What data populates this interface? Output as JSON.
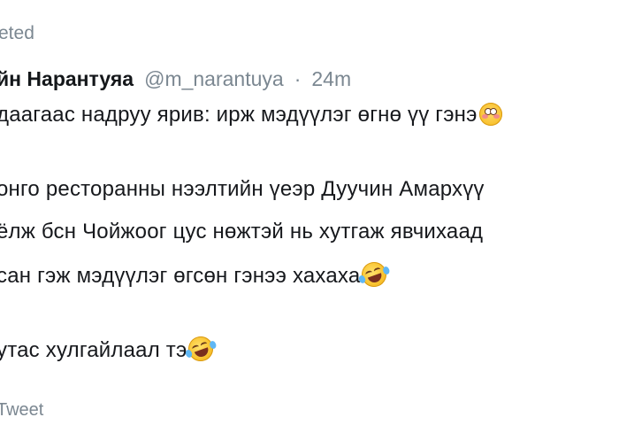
{
  "tweet": {
    "retweet_label": "eted",
    "author_name": "йн Нарантуяа",
    "handle": "@m_narantuya",
    "separator": "·",
    "time": "24m",
    "lines": [
      "даагаас надруу ярив: ирж мэдүүлэг өгнө үү гэнэ",
      "онго ресторанны нээлтийн үеэр Дуучин Амархүү",
      "ёлж бсн Чойжоог цус нөжтэй нь хутгаж явчихаад",
      "сан гэж мэдүүлэг өгсөн гэнээ хахаха",
      "утас хулгайлаал тэ"
    ],
    "emoji": [
      "flushed-face-icon",
      "rolling-laughing-icon",
      "rolling-laughing-icon"
    ],
    "footer_label": "Tweet"
  }
}
